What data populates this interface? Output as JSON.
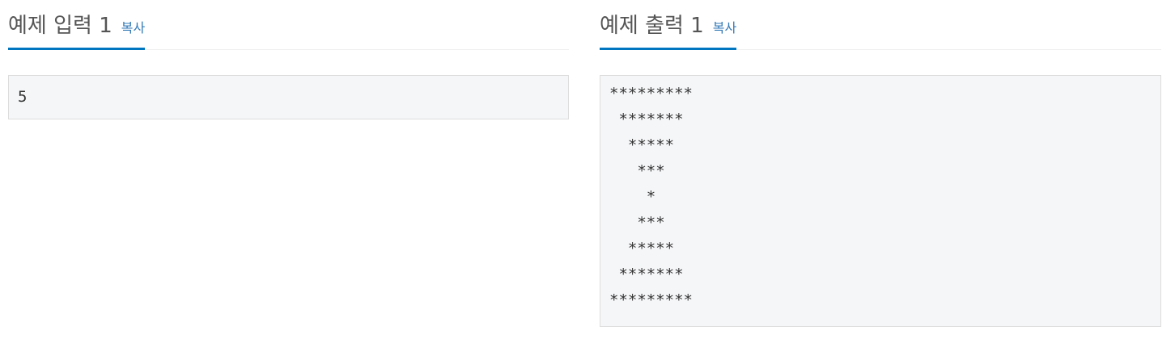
{
  "sample_input": {
    "title": "예제 입력 1",
    "copy_label": "복사",
    "content": "5"
  },
  "sample_output": {
    "title": "예제 출력 1",
    "copy_label": "복사",
    "content": "*********\n *******\n  *****\n   ***\n    *\n   ***\n  *****\n *******\n*********"
  },
  "colors": {
    "accent": "#0076c0",
    "link": "#337ab7",
    "box_background": "#f5f6f8"
  }
}
